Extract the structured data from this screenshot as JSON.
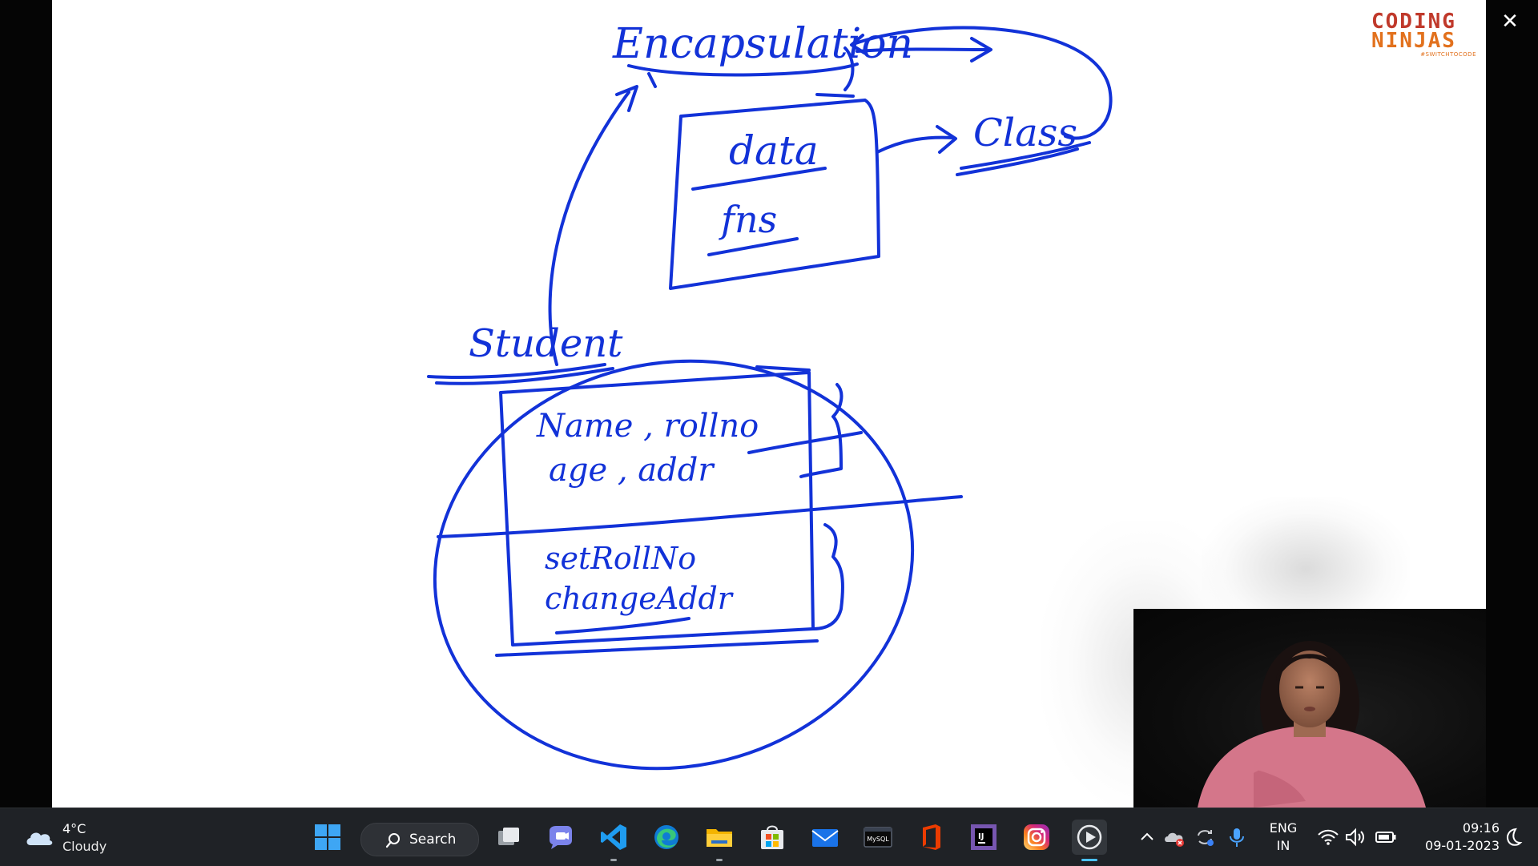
{
  "whiteboard": {
    "labels": {
      "encapsulation": "Encapsulation",
      "data": "data",
      "fns": "fns",
      "class": "Class",
      "student": "Student",
      "name_rollno": "Name , rollno",
      "age_addr": "age , addr",
      "set_rollno": "setRollNo",
      "change_addr": "changeAddr"
    },
    "ink_color": "#1232d8"
  },
  "logo": {
    "line1": "CODING",
    "line2": "NINJAS",
    "tagline": "#SWITCHTOCODE"
  },
  "close_icon": "close-icon",
  "taskbar": {
    "weather": {
      "temperature": "4°C",
      "condition": "Cloudy",
      "icon": "cloud-icon"
    },
    "search_label": "Search",
    "pinned": [
      {
        "name": "start-button",
        "icon": "windows-icon"
      },
      {
        "name": "task-view-button",
        "icon": "task-view-icon"
      },
      {
        "name": "teams-chat-button",
        "icon": "chat-icon"
      },
      {
        "name": "vscode-button",
        "icon": "vscode-icon"
      },
      {
        "name": "edge-button",
        "icon": "edge-icon"
      },
      {
        "name": "file-explorer-button",
        "icon": "folder-icon"
      },
      {
        "name": "store-button",
        "icon": "store-icon"
      },
      {
        "name": "mail-button",
        "icon": "mail-icon"
      },
      {
        "name": "mysql-button",
        "icon": "mysql-icon"
      },
      {
        "name": "office-button",
        "icon": "office-icon"
      },
      {
        "name": "intellij-button",
        "icon": "intellij-icon"
      },
      {
        "name": "instagram-button",
        "icon": "instagram-icon"
      },
      {
        "name": "media-player-button",
        "icon": "play-icon"
      }
    ],
    "mysql_label": "MySQL",
    "intellij_label": "IJ",
    "language": {
      "line1": "ENG",
      "line2": "IN"
    },
    "clock": {
      "time": "09:16",
      "date": "09-01-2023"
    }
  }
}
